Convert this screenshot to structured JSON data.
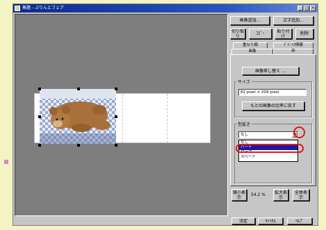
{
  "window": {
    "title": "無題 - ぷりんとフェア",
    "controls": [
      "_",
      "□",
      "×"
    ]
  },
  "toolbar": {
    "add_image": "画像追加...",
    "add_text": "文字追加...",
    "cut": "切り取り",
    "copy": "ｺﾋﾟｰ",
    "paste": "貼り付け",
    "delete": "削除"
  },
  "tabs": {
    "overlap": "重なり順",
    "device_info": "ﾃﾞﾊﾞｲｽ情報",
    "image": "画像",
    "frame": "枠"
  },
  "image_tab": {
    "replace_button": "画像差し替え ...",
    "size_label": "サイズ",
    "size_value": "82 pixel × 209 pixel",
    "restore_ratio_button": "もとの画像の比率に戻す",
    "crop_label": "型抜き",
    "crop_selected": "なし",
    "crop_options": [
      "なし",
      "ハート",
      "クラブ",
      "スペード"
    ]
  },
  "zoom": {
    "zoom_out": "縮小表示",
    "value": "54.2 %",
    "zoom_in": "拡大表示",
    "full": "全体表示"
  },
  "footer": {
    "ok": "決定",
    "cancel": "ｷｬﾝｾﾙ",
    "help": "ﾍﾙﾌﾟ"
  }
}
